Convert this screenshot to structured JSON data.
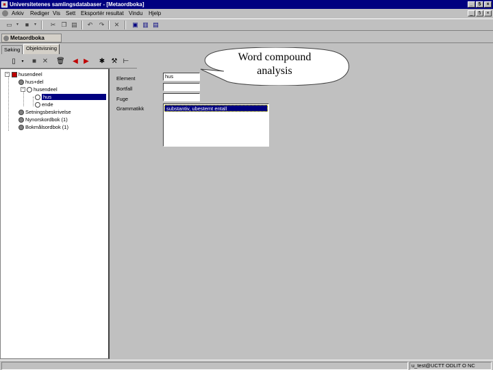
{
  "window": {
    "title": "Universitetenes samlingsdatabaser - [Metaordboka]",
    "controls": [
      "_",
      "5",
      "×"
    ],
    "doc_controls": [
      "_",
      "5",
      "×"
    ]
  },
  "menubar": {
    "items": [
      "Arkiv",
      "Rediger",
      "Vis",
      "Sett",
      "Eksportér resultat",
      "Vindu",
      "Hjelp"
    ]
  },
  "document": {
    "title": "Metaordboka"
  },
  "tabs": [
    {
      "label": "Søking",
      "active": false
    },
    {
      "label": "Objektvisning",
      "active": true
    }
  ],
  "tree": {
    "items": [
      {
        "label": "husendeel",
        "level": 0
      },
      {
        "label": "hus+del",
        "level": 1
      },
      {
        "label": "husendeel",
        "level": 2
      },
      {
        "label": "hus",
        "level": 3,
        "selected": true
      },
      {
        "label": "ende",
        "level": 3
      },
      {
        "label": "Setningsbeskrivelse",
        "level": 1
      },
      {
        "label": "Nynorskordbok (1)",
        "level": 1
      },
      {
        "label": "Bokmålsordbok (1)",
        "level": 1
      }
    ]
  },
  "form": {
    "element_label": "Element",
    "element_value": "hus",
    "bortfall_label": "Bortfall",
    "bortfall_value": "",
    "fuge_label": "Fuge",
    "fuge_value": "",
    "grammatikk_label": "Grammatikk",
    "grammatikk_items": [
      "substantiv, ubestemt entall"
    ]
  },
  "callout": {
    "line1": "Word compound",
    "line2": "analysis"
  },
  "statusbar": {
    "user": "u_test@UCTT ODLIT O NC"
  },
  "colors": {
    "titlebar": "#000080",
    "selection": "#000080",
    "face": "#c0c0c0"
  }
}
